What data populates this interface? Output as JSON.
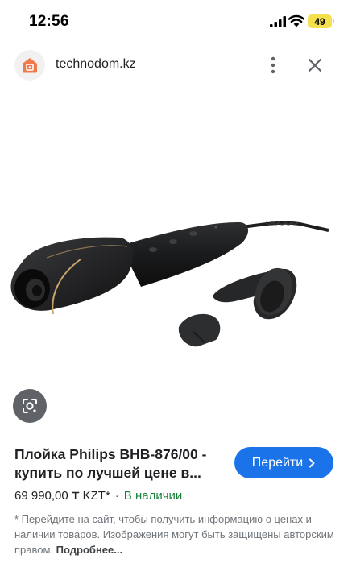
{
  "status_bar": {
    "time": "12:56",
    "battery": "49",
    "icons": [
      "signal-icon",
      "wifi-icon",
      "battery-icon"
    ]
  },
  "browser": {
    "host": "technodom.kz",
    "icons": [
      "site-icon",
      "more-vert-icon",
      "close-icon"
    ]
  },
  "product": {
    "image_icon": "hair-curler-product-image",
    "lens_icon": "google-lens-icon"
  },
  "result": {
    "title": "Плойка Philips BHB-876/00 - купить по лучшей цене в...",
    "go_label": "Перейти",
    "go_icon": "chevron-right-icon",
    "price": "69 990,00 ₸ KZT*",
    "separator": "·",
    "availability": "В наличии"
  },
  "disclaimer": {
    "text": "* Перейдите на сайт, чтобы получить информацию о ценах и наличии товаров. Изображения могут быть защищены авторским правом.",
    "more_label": "Подробнее..."
  },
  "colors": {
    "accent": "#1a73e8",
    "in_stock": "#188038",
    "battery": "#f4e04d"
  }
}
